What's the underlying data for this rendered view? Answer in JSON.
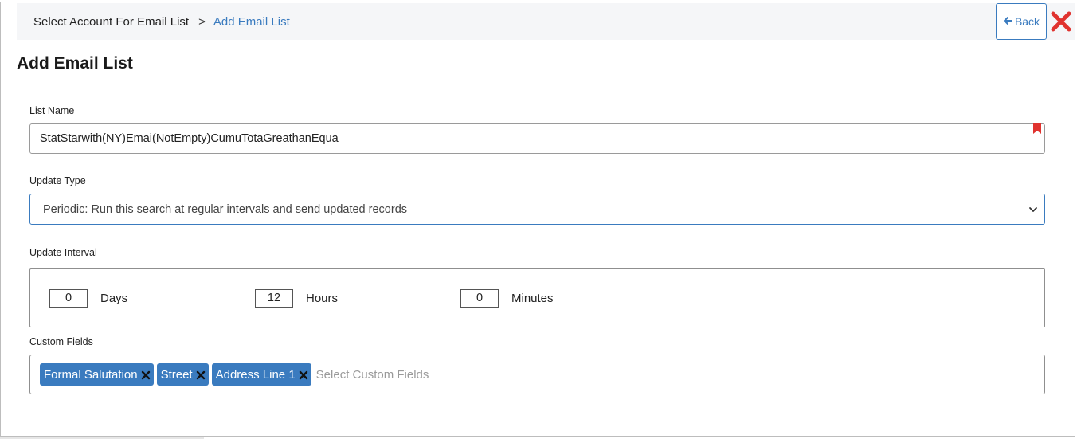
{
  "breadcrumb": {
    "home": "Select Account For Email List",
    "separator": ">",
    "current": "Add Email List"
  },
  "header": {
    "back_label": "Back",
    "back_icon": "arrow-left-icon",
    "close_icon": "close-icon"
  },
  "page": {
    "title": "Add Email List"
  },
  "form": {
    "list_name": {
      "label": "List Name",
      "value": "StatStarwith(NY)Emai(NotEmpty)CumuTotaGreathanEqua"
    },
    "update_type": {
      "label": "Update Type",
      "selected": "Periodic: Run this search at regular intervals and send updated records"
    },
    "update_interval": {
      "label": "Update Interval",
      "days": {
        "value": "0",
        "label": "Days"
      },
      "hours": {
        "value": "12",
        "label": "Hours"
      },
      "minutes": {
        "value": "0",
        "label": "Minutes"
      }
    },
    "custom_fields": {
      "label": "Custom Fields",
      "tags": [
        "Formal Salutation",
        "Street",
        "Address Line 1"
      ],
      "placeholder": "Select Custom Fields"
    }
  },
  "colors": {
    "accent": "#3a7bbf",
    "close": "#e0332f",
    "required_marker": "#e0332f"
  }
}
